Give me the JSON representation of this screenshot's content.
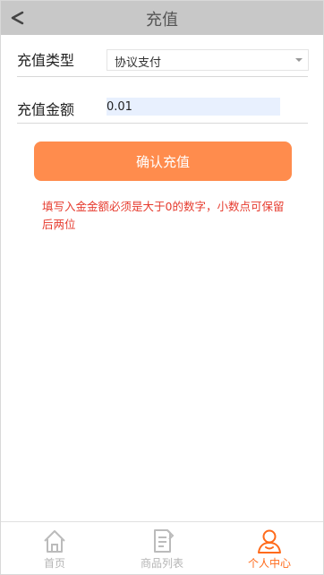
{
  "header": {
    "title": "充值",
    "back_icon": "back-arrow-icon"
  },
  "form": {
    "type_label": "充值类型",
    "type_value": "协议支付",
    "amount_label": "充值金额",
    "amount_value": "0.01"
  },
  "confirm_button": "确认充值",
  "hint": "填写入金金额必须是大于0的数字，小数点可保留后两位",
  "tabbar": {
    "items": [
      {
        "label": "首页",
        "icon": "home-icon",
        "active": false
      },
      {
        "label": "商品列表",
        "icon": "list-icon",
        "active": false
      },
      {
        "label": "个人中心",
        "icon": "user-icon",
        "active": true
      }
    ]
  },
  "colors": {
    "header_bg": "#c8c8c8",
    "accent": "#ff8c4d",
    "active_tab": "#ff6a1a",
    "hint": "#e63b2e"
  }
}
